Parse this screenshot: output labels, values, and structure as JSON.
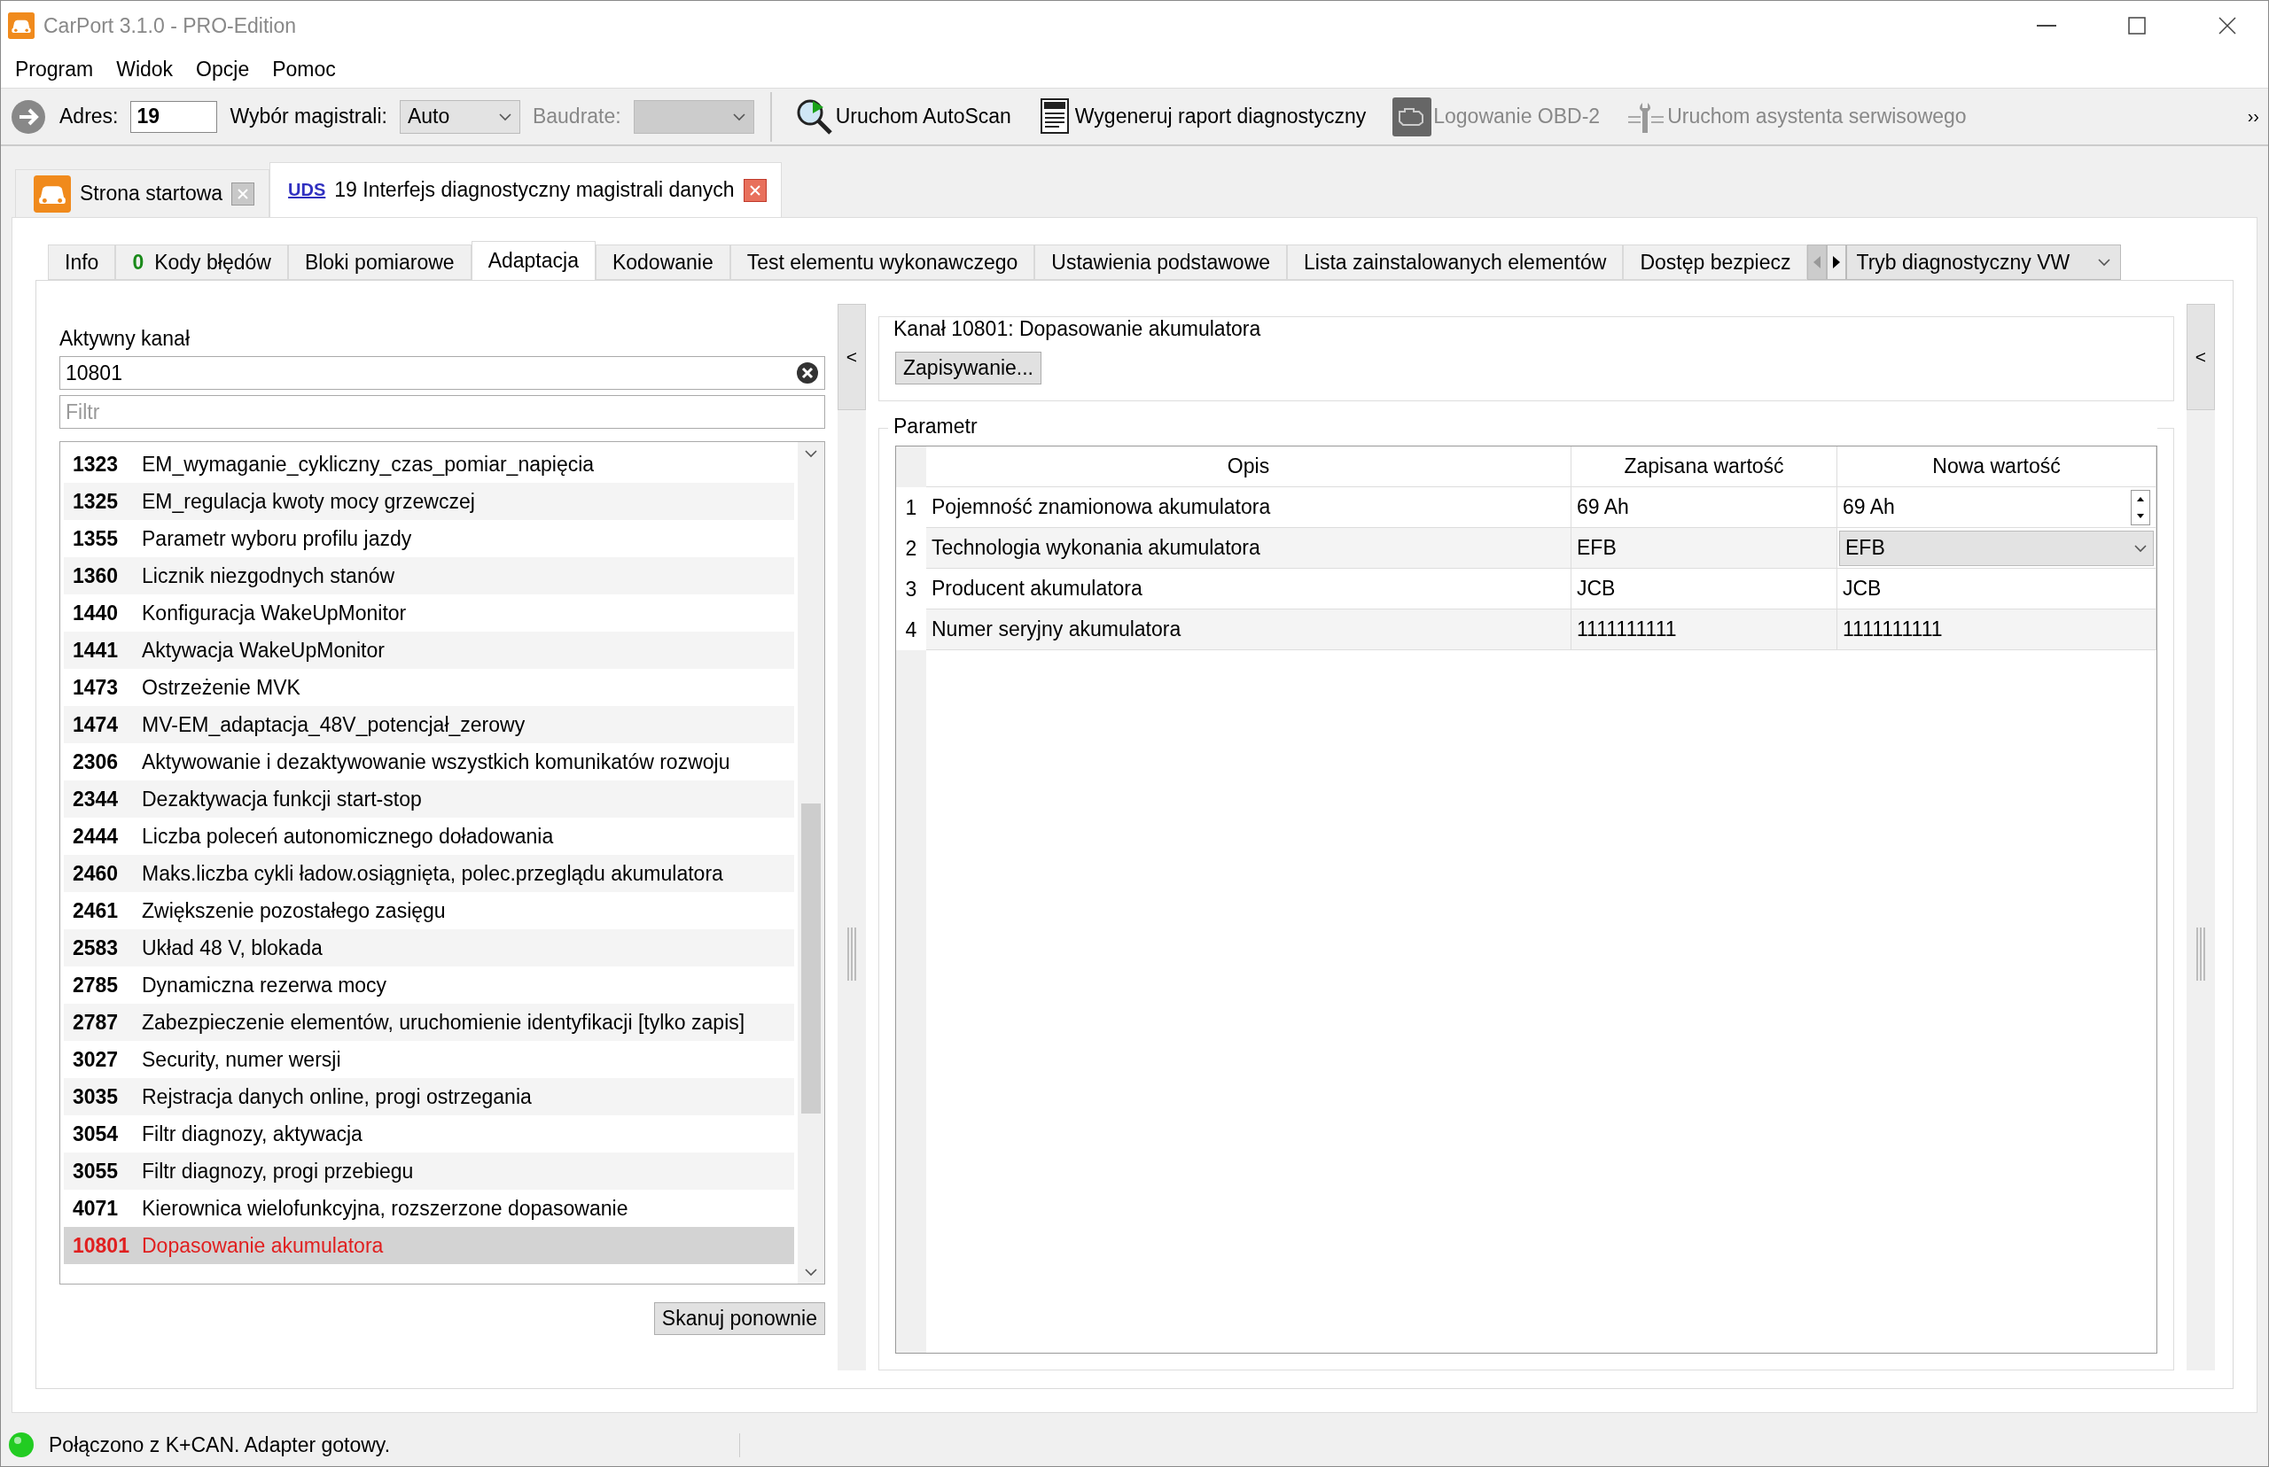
{
  "window": {
    "title": "CarPort 3.1.0 - PRO-Edition"
  },
  "menu": [
    "Program",
    "Widok",
    "Opcje",
    "Pomoc"
  ],
  "toolbar": {
    "address_label": "Adres:",
    "address": "19",
    "bus_label": "Wybór magistrali:",
    "bus": "Auto",
    "baud_label": "Baudrate:",
    "baud_disabled": true,
    "overflow": "››",
    "actions": [
      {
        "kind": "scan",
        "label": "Uruchom AutoScan",
        "disabled": false
      },
      {
        "kind": "report",
        "label": "Wygeneruj raport diagnostyczny",
        "disabled": false
      },
      {
        "kind": "engine",
        "label": "Logowanie OBD-2",
        "disabled": true
      },
      {
        "kind": "service",
        "label": "Uruchom asystenta serwisowego",
        "disabled": true
      }
    ]
  },
  "doc_tabs": [
    {
      "kind": "home",
      "label": "Strona startowa",
      "selected": false
    },
    {
      "kind": "uds",
      "badge": "UDS",
      "label": "19 Interfejs diagnostyczny magistrali danych",
      "selected": true
    }
  ],
  "tabs": [
    {
      "label": "Info",
      "selected": false
    },
    {
      "count": "0",
      "label": "Kody błędów",
      "selected": false
    },
    {
      "label": "Bloki pomiarowe",
      "selected": false
    },
    {
      "label": "Adaptacja",
      "selected": true
    },
    {
      "label": "Kodowanie",
      "selected": false
    },
    {
      "label": "Test elementu wykonawczego",
      "selected": false
    },
    {
      "label": "Ustawienia podstawowe",
      "selected": false
    },
    {
      "label": "Lista zainstalowanych elementów",
      "selected": false
    },
    {
      "label": "Dostęp bezpiecz",
      "selected": false
    }
  ],
  "mode_select": "Tryb diagnostyczny VW",
  "channel": {
    "label": "Aktywny kanał",
    "value": "10801",
    "filter_placeholder": "Filtr"
  },
  "channels": [
    {
      "id": "1323",
      "name": "EM_wymaganie_cykliczny_czas_pomiar_napięcia",
      "selected": false
    },
    {
      "id": "1325",
      "name": "EM_regulacja kwoty mocy grzewczej",
      "selected": false
    },
    {
      "id": "1355",
      "name": "Parametr wyboru profilu jazdy",
      "selected": false
    },
    {
      "id": "1360",
      "name": "Licznik niezgodnych stanów",
      "selected": false
    },
    {
      "id": "1440",
      "name": "Konfiguracja WakeUpMonitor",
      "selected": false
    },
    {
      "id": "1441",
      "name": "Aktywacja WakeUpMonitor",
      "selected": false
    },
    {
      "id": "1473",
      "name": "Ostrzeżenie MVK",
      "selected": false
    },
    {
      "id": "1474",
      "name": "MV-EM_adaptacja_48V_potencjał_zerowy",
      "selected": false
    },
    {
      "id": "2306",
      "name": "Aktywowanie i dezaktywowanie wszystkich komunikatów rozwoju",
      "selected": false
    },
    {
      "id": "2344",
      "name": "Dezaktywacja funkcji start-stop",
      "selected": false
    },
    {
      "id": "2444",
      "name": "Liczba poleceń autonomicznego doładowania",
      "selected": false
    },
    {
      "id": "2460",
      "name": "Maks.liczba cykli ładow.osiągnięta, polec.przeglądu akumulatora",
      "selected": false
    },
    {
      "id": "2461",
      "name": "Zwiększenie pozostałego zasięgu",
      "selected": false
    },
    {
      "id": "2583",
      "name": "Układ 48 V, blokada",
      "selected": false
    },
    {
      "id": "2785",
      "name": "Dynamiczna rezerwa mocy",
      "selected": false
    },
    {
      "id": "2787",
      "name": "Zabezpieczenie elementów, uruchomienie identyfikacji [tylko zapis]",
      "selected": false
    },
    {
      "id": "3027",
      "name": "Security, numer wersji",
      "selected": false
    },
    {
      "id": "3035",
      "name": "Rejstracja danych online, progi ostrzegania",
      "selected": false
    },
    {
      "id": "3054",
      "name": "Filtr diagnozy, aktywacja",
      "selected": false
    },
    {
      "id": "3055",
      "name": "Filtr diagnozy, progi przebiegu",
      "selected": false
    },
    {
      "id": "4071",
      "name": "Kierownica wielofunkcyjna, rozszerzone dopasowanie",
      "selected": false
    },
    {
      "id": "10801",
      "name": "Dopasowanie akumulatora",
      "selected": true
    }
  ],
  "rescan": "Skanuj ponownie",
  "collapse_left": "<",
  "collapse_right": "<",
  "channel_box": {
    "title": "Kanał 10801: Dopasowanie akumulatora",
    "button": "Zapisywanie..."
  },
  "params": {
    "title": "Parametr",
    "columns": [
      "Opis",
      "Zapisana wartość",
      "Nowa wartość"
    ],
    "rows": [
      {
        "index": "1",
        "desc": "Pojemność znamionowa akumulatora",
        "saved": "69 Ah",
        "new": "69 Ah",
        "kind": "spin"
      },
      {
        "index": "2",
        "desc": "Technologia wykonania akumulatora",
        "saved": "EFB",
        "new": "EFB",
        "kind": "select"
      },
      {
        "index": "3",
        "desc": "Producent akumulatora",
        "saved": "JCB",
        "new": "JCB",
        "kind": "text"
      },
      {
        "index": "4",
        "desc": "Numer seryjny akumulatora",
        "saved": "1111111111",
        "new": "1111111111",
        "kind": "text"
      }
    ]
  },
  "status_bar": {
    "text": "Połączono z K+CAN. Adapter gotowy.",
    "connected": true
  }
}
